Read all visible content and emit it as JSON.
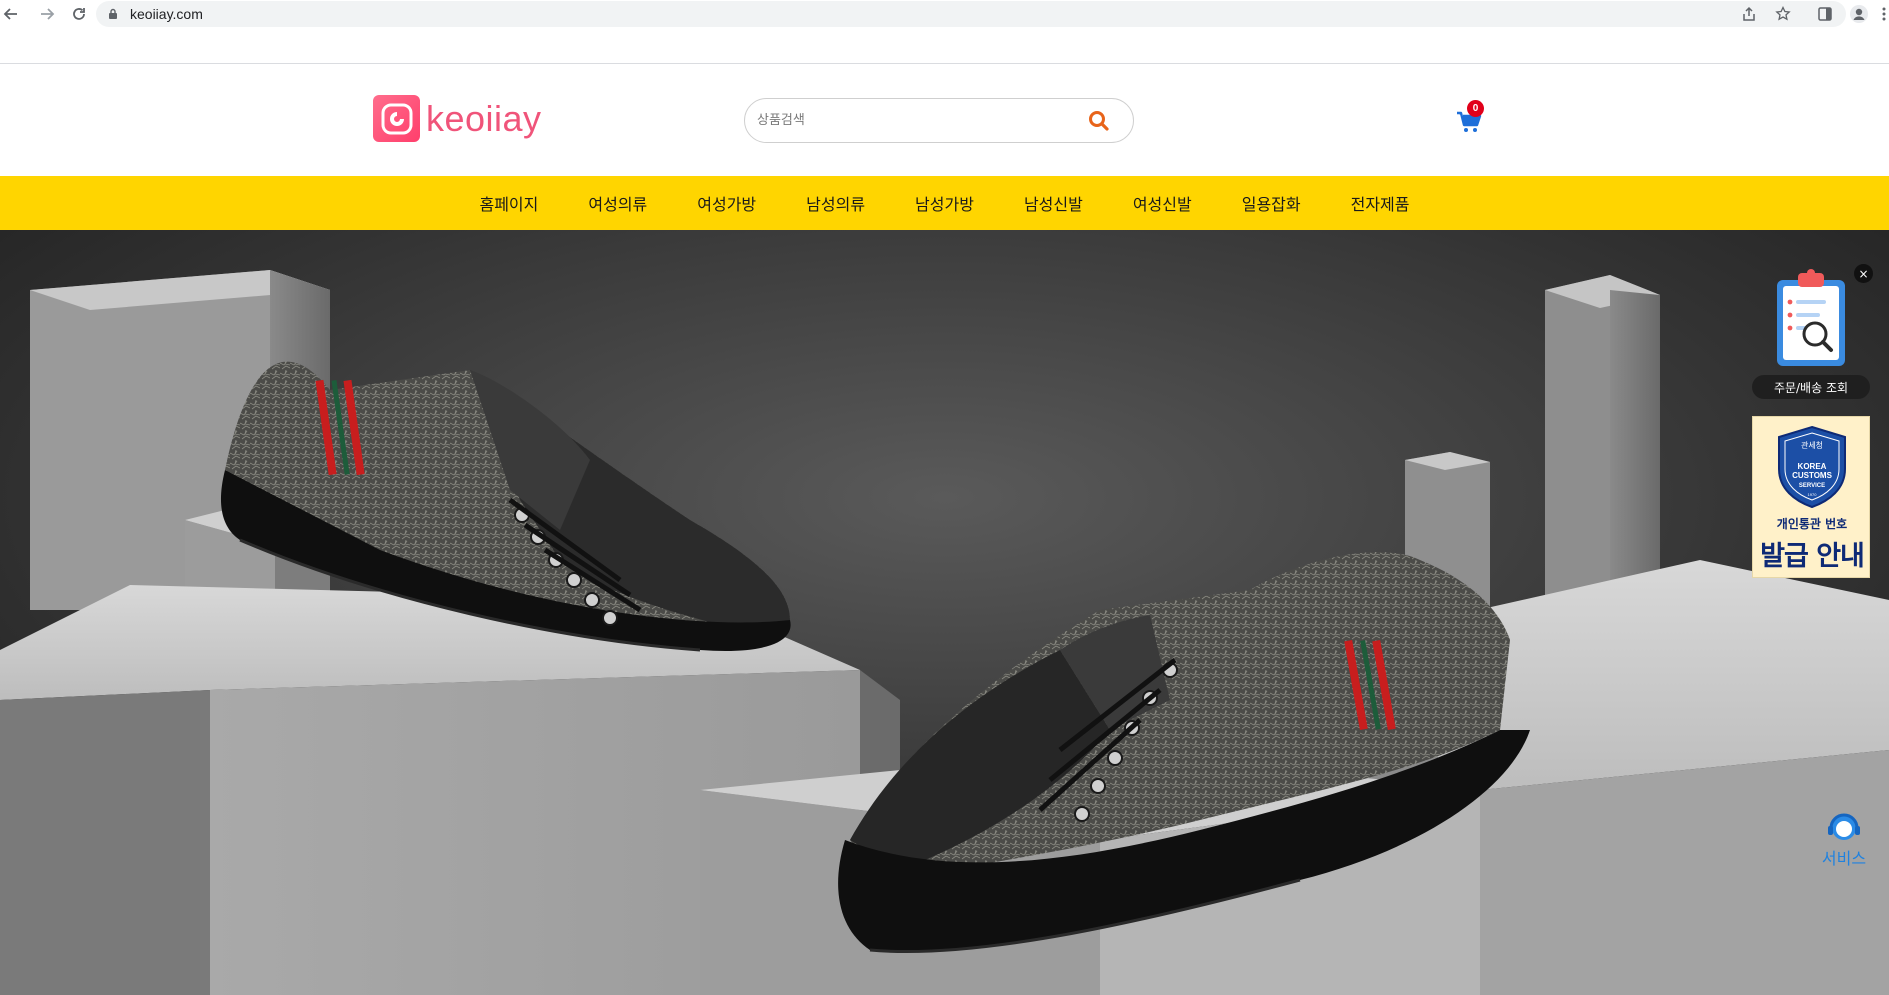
{
  "browser": {
    "url": "keoiiay.com"
  },
  "header": {
    "logo_text": "keoiiay",
    "search": {
      "placeholder": "상품검색"
    },
    "cart": {
      "count": "0"
    }
  },
  "nav": {
    "items": [
      "홈페이지",
      "여성의류",
      "여성가방",
      "남성의류",
      "남성가방",
      "남성신발",
      "여성신발",
      "일용잡화",
      "전자제품"
    ]
  },
  "side_widgets": {
    "close_label": "×",
    "order_lookup_label": "주문/배송 조회",
    "customs": {
      "seal_top": "관세청",
      "seal_text_1": "KOREA",
      "seal_text_2": "CUSTOMS",
      "seal_text_3": "SERVICE",
      "seal_year": "1970",
      "line1": "개인통관 번호",
      "line2": "발급 안내"
    },
    "service_label": "서비스"
  },
  "colors": {
    "nav_bg": "#ffd500",
    "brand_pink": "#f0547a",
    "search_icon": "#e8641a",
    "cart_icon": "#1e6fd9",
    "badge": "#e1001a"
  }
}
